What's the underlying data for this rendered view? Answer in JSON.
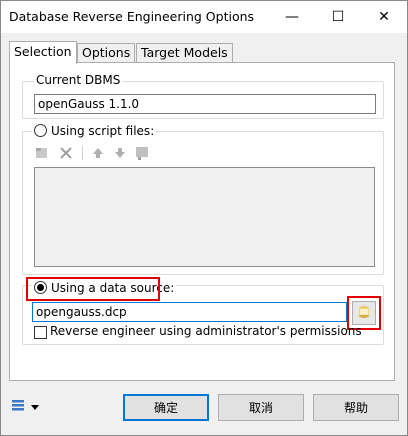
{
  "window": {
    "title": "Database Reverse Engineering Options",
    "minimize_glyph": "—",
    "maximize_glyph": "☐",
    "close_glyph": "✕"
  },
  "tabs": [
    {
      "label": "Selection",
      "active": true
    },
    {
      "label": "Options",
      "active": false
    },
    {
      "label": "Target Models",
      "active": false
    }
  ],
  "current_dbms": {
    "legend": "Current DBMS",
    "value": "openGauss 1.1.0"
  },
  "script_files": {
    "label": "Using script files:",
    "selected": false,
    "toolbar_icons": [
      "add-file-icon",
      "delete-icon",
      "move-up-icon",
      "move-down-icon",
      "browse-icon"
    ]
  },
  "data_source": {
    "label": "Using a data source:",
    "selected": true,
    "value": "opengauss.dcp",
    "browse_icon": "database-browse-icon",
    "highlight_color": "#e00000"
  },
  "admin_permissions": {
    "label": "Reverse engineer using administrator's permissions",
    "checked": false
  },
  "footer": {
    "menu_icon": "list-menu-icon",
    "ok_label": "确定",
    "cancel_label": "取消",
    "help_label": "帮助"
  },
  "colors": {
    "accent": "#0078d7",
    "highlight": "#e00000"
  }
}
